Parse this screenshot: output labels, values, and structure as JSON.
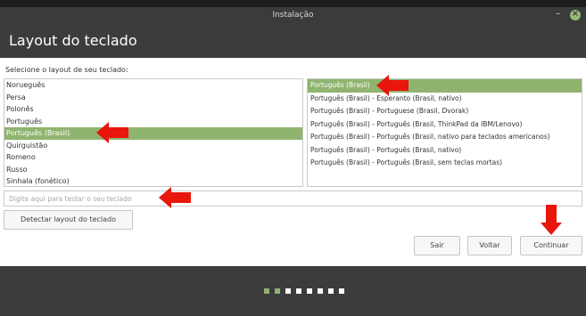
{
  "window": {
    "title": "Instalação",
    "minimize_glyph": "–",
    "close_glyph": "×"
  },
  "page": {
    "title": "Layout do teclado"
  },
  "prompt": "Selecione o layout de seu teclado:",
  "layouts": [
    {
      "label": "Norueguês",
      "selected": false
    },
    {
      "label": "Persa",
      "selected": false
    },
    {
      "label": "Polonês",
      "selected": false
    },
    {
      "label": "Português",
      "selected": false
    },
    {
      "label": "Português (Brasil)",
      "selected": true
    },
    {
      "label": "Quirguistão",
      "selected": false
    },
    {
      "label": "Romeno",
      "selected": false
    },
    {
      "label": "Russo",
      "selected": false
    },
    {
      "label": "Sinhala (fonético)",
      "selected": false
    }
  ],
  "variants": [
    {
      "label": "Português (Brasil)",
      "selected": true
    },
    {
      "label": "Português (Brasil) - Esperanto (Brasil, nativo)",
      "selected": false
    },
    {
      "label": "Português (Brasil) - Portuguese (Brasil, Dvorak)",
      "selected": false
    },
    {
      "label": "Português (Brasil) - Português (Brasil, ThinkPad da IBM/Lenovo)",
      "selected": false
    },
    {
      "label": "Português (Brasil) - Português (Brasil, nativo para teclados americanos)",
      "selected": false
    },
    {
      "label": "Português (Brasil) - Português (Brasil, nativo)",
      "selected": false
    },
    {
      "label": "Português (Brasil) - Português (Brasil, sem teclas mortas)",
      "selected": false
    }
  ],
  "test_input": {
    "placeholder": "Digite aqui para testar o seu teclado",
    "value": ""
  },
  "buttons": {
    "detect": "Detectar layout do teclado",
    "quit": "Sair",
    "back": "Voltar",
    "continue": "Continuar"
  },
  "progress": {
    "completed_steps": 2,
    "total_steps": 8
  },
  "colors": {
    "accent": "#8fb46f",
    "header": "#3c3c3c",
    "arrow": "#e8160c"
  },
  "annotations": [
    "red-arrow-icon",
    "red-arrow-icon",
    "red-arrow-icon",
    "red-arrow-icon"
  ]
}
